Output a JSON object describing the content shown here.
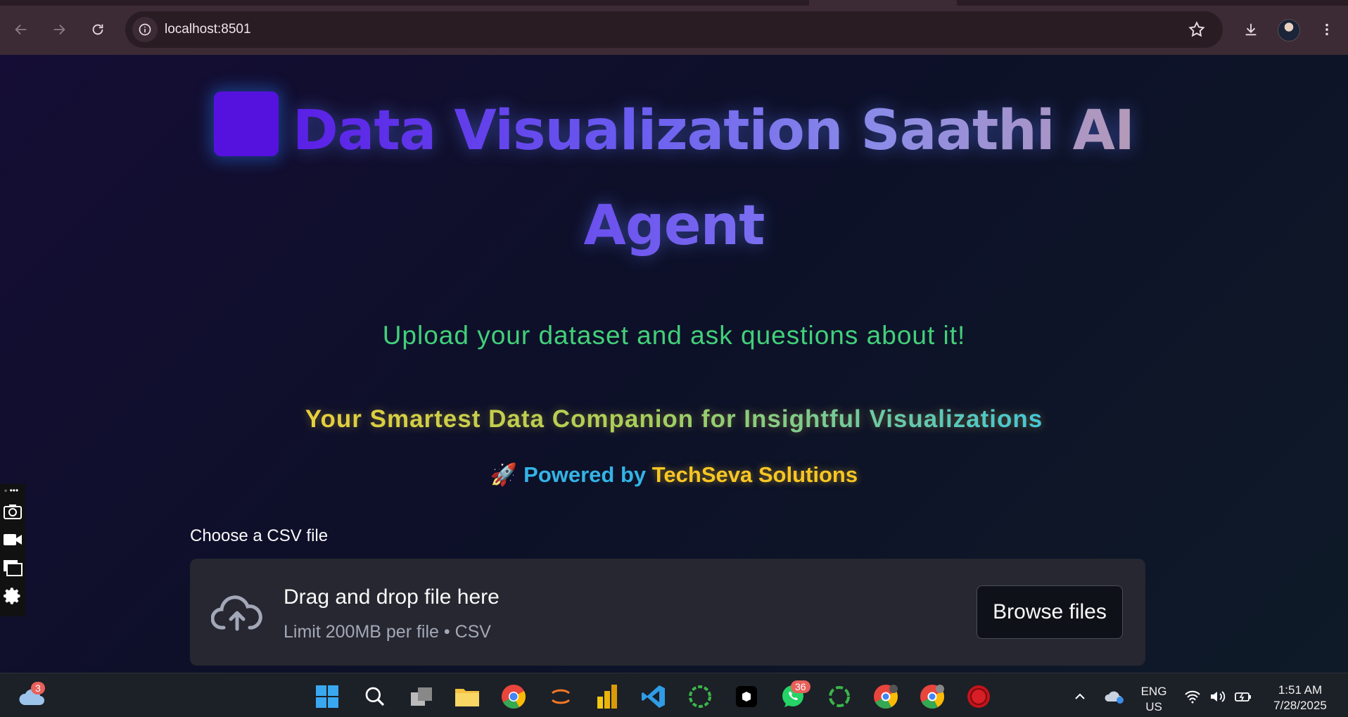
{
  "browser": {
    "url": "localhost:8501"
  },
  "page": {
    "title_line1": "Data Visualization Saathi AI",
    "title_line2": "Agent",
    "subtitle": "Upload your dataset and ask questions about it!",
    "tagline": "Your Smartest Data Companion for Insightful Visualizations",
    "powered_emoji": "🚀",
    "powered_prefix": "Powered by",
    "powered_brand": "TechSeva Solutions",
    "uploader": {
      "label": "Choose a CSV file",
      "drop_text": "Drag and drop file here",
      "limit_text": "Limit 200MB per file • CSV",
      "browse_label": "Browse files"
    }
  },
  "taskbar": {
    "weather_badge": "3",
    "whatsapp_badge": "36",
    "language_line1": "ENG",
    "language_line2": "US",
    "time": "1:51 AM",
    "date": "7/28/2025"
  },
  "colors": {
    "accent_purple": "#5511dd",
    "subtitle_green": "#42d07a",
    "brand_gold": "#f8c623",
    "powered_blue": "#33b4e6"
  }
}
